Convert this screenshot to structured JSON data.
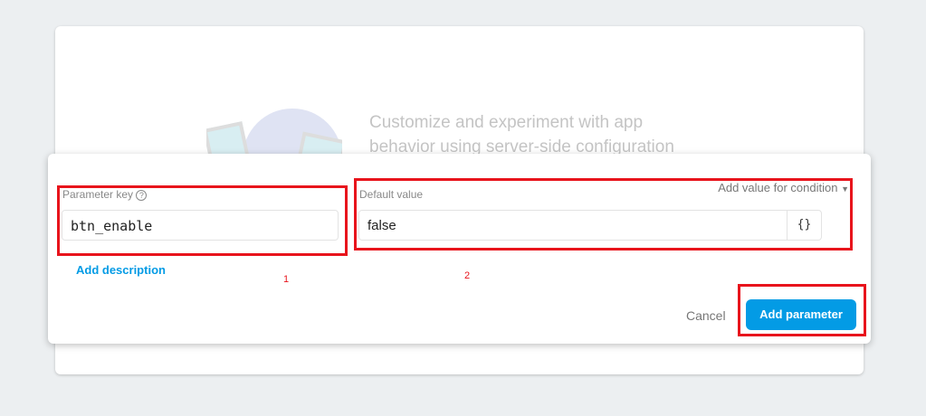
{
  "background": {
    "tagline_line1": "Customize and experiment with app",
    "tagline_line2": "behavior using server-side configuration"
  },
  "dialog": {
    "param_key_label": "Parameter key",
    "param_key_value": "btn_enable",
    "add_description": "Add description",
    "default_value_label": "Default value",
    "default_value": "false",
    "json_button": "{}",
    "add_condition": "Add value for condition",
    "cancel": "Cancel",
    "add_parameter": "Add parameter"
  },
  "annotations": {
    "one": "1",
    "two": "2"
  },
  "colors": {
    "accent": "#039be5",
    "highlight": "#e8141c"
  }
}
